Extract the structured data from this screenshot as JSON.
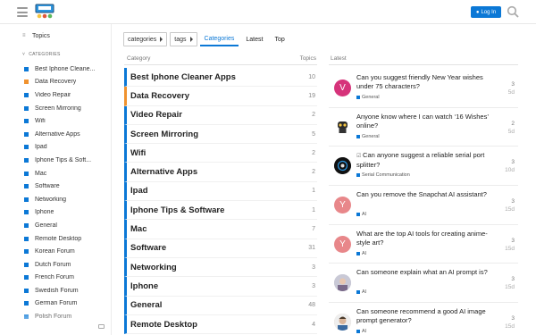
{
  "header": {
    "login_label": "Log In",
    "login_icon": "user-icon",
    "menu_icon": "hamburger-icon",
    "search_icon": "search-icon",
    "logo_icon": "site-logo"
  },
  "sidebar": {
    "topics_label": "Topics",
    "section_label": "CATEGORIES",
    "items": [
      {
        "label": "Best Iphone Cleane...",
        "color": "#0b78d6"
      },
      {
        "label": "Data Recovery",
        "color": "#f0922e"
      },
      {
        "label": "Video Repair",
        "color": "#0b78d6"
      },
      {
        "label": "Screen Mirroring",
        "color": "#0b78d6"
      },
      {
        "label": "Wifi",
        "color": "#0b78d6"
      },
      {
        "label": "Alternative Apps",
        "color": "#0b78d6"
      },
      {
        "label": "Ipad",
        "color": "#0b78d6"
      },
      {
        "label": "Iphone Tips & Soft...",
        "color": "#0b78d6"
      },
      {
        "label": "Mac",
        "color": "#0b78d6"
      },
      {
        "label": "Software",
        "color": "#0b78d6"
      },
      {
        "label": "Networking",
        "color": "#0b78d6"
      },
      {
        "label": "Iphone",
        "color": "#0b78d6"
      },
      {
        "label": "General",
        "color": "#0b78d6"
      },
      {
        "label": "Remote Desktop",
        "color": "#0b78d6"
      },
      {
        "label": "Korean Forum",
        "color": "#0b78d6"
      },
      {
        "label": "Dutch Forum",
        "color": "#0b78d6"
      },
      {
        "label": "French Forum",
        "color": "#0b78d6"
      },
      {
        "label": "Swedish Forum",
        "color": "#0b78d6"
      },
      {
        "label": "German Forum",
        "color": "#0b78d6"
      },
      {
        "label": "Polish Forum",
        "color": "#0b78d6"
      }
    ]
  },
  "nav": {
    "categories_dropdown": "categories",
    "tags_dropdown": "tags",
    "tabs": [
      "Categories",
      "Latest",
      "Top"
    ],
    "active_tab": "Categories"
  },
  "categories": {
    "header_category": "Category",
    "header_topics": "Topics",
    "rows": [
      {
        "name": "Best Iphone Cleaner Apps",
        "count": "10",
        "color": "#0b78d6"
      },
      {
        "name": "Data Recovery",
        "count": "19",
        "color": "#f0922e"
      },
      {
        "name": "Video Repair",
        "count": "2",
        "color": "#0b78d6"
      },
      {
        "name": "Screen Mirroring",
        "count": "5",
        "color": "#0b78d6"
      },
      {
        "name": "Wifi",
        "count": "2",
        "color": "#0b78d6"
      },
      {
        "name": "Alternative Apps",
        "count": "2",
        "color": "#0b78d6"
      },
      {
        "name": "Ipad",
        "count": "1",
        "color": "#0b78d6"
      },
      {
        "name": "Iphone Tips & Software",
        "count": "1",
        "color": "#0b78d6"
      },
      {
        "name": "Mac",
        "count": "7",
        "color": "#0b78d6"
      },
      {
        "name": "Software",
        "count": "31",
        "color": "#0b78d6"
      },
      {
        "name": "Networking",
        "count": "3",
        "color": "#0b78d6"
      },
      {
        "name": "Iphone",
        "count": "3",
        "color": "#0b78d6"
      },
      {
        "name": "General",
        "count": "48",
        "color": "#0b78d6"
      },
      {
        "name": "Remote Desktop",
        "count": "4",
        "color": "#0b78d6"
      }
    ]
  },
  "latest": {
    "header": "Latest",
    "rows": [
      {
        "title": "Can you suggest friendly New Year wishes under 75 characters?",
        "category": "General",
        "posts": "3",
        "age": "5d",
        "avatar_letter": "V",
        "avatar_color": "#d6337a",
        "pinned": false
      },
      {
        "title": "Anyone know where I can watch ‘16 Wishes’ online?",
        "category": "General",
        "posts": "2",
        "age": "5d",
        "avatar_letter": "",
        "avatar_color": "#ffffff",
        "pinned": false
      },
      {
        "title": "Can anyone suggest a reliable serial port splitter?",
        "category": "Serial Communication",
        "posts": "3",
        "age": "10d",
        "avatar_letter": "",
        "avatar_color": "#111111",
        "pinned": true
      },
      {
        "title": "Can you remove the Snapchat AI assistant?",
        "category": "AI",
        "posts": "3",
        "age": "15d",
        "avatar_letter": "Y",
        "avatar_color": "#e8878a",
        "pinned": false
      },
      {
        "title": "What are the top AI tools for creating anime-style art?",
        "category": "AI",
        "posts": "3",
        "age": "15d",
        "avatar_letter": "Y",
        "avatar_color": "#e8878a",
        "pinned": false
      },
      {
        "title": "Can someone explain what an AI prompt is?",
        "category": "AI",
        "posts": "3",
        "age": "15d",
        "avatar_letter": "",
        "avatar_color": "#c9c9d6",
        "pinned": false
      },
      {
        "title": "Can someone recommend a good AI image prompt generator?",
        "category": "AI",
        "posts": "3",
        "age": "15d",
        "avatar_letter": "",
        "avatar_color": "#d9c2b0",
        "pinned": false
      }
    ]
  }
}
